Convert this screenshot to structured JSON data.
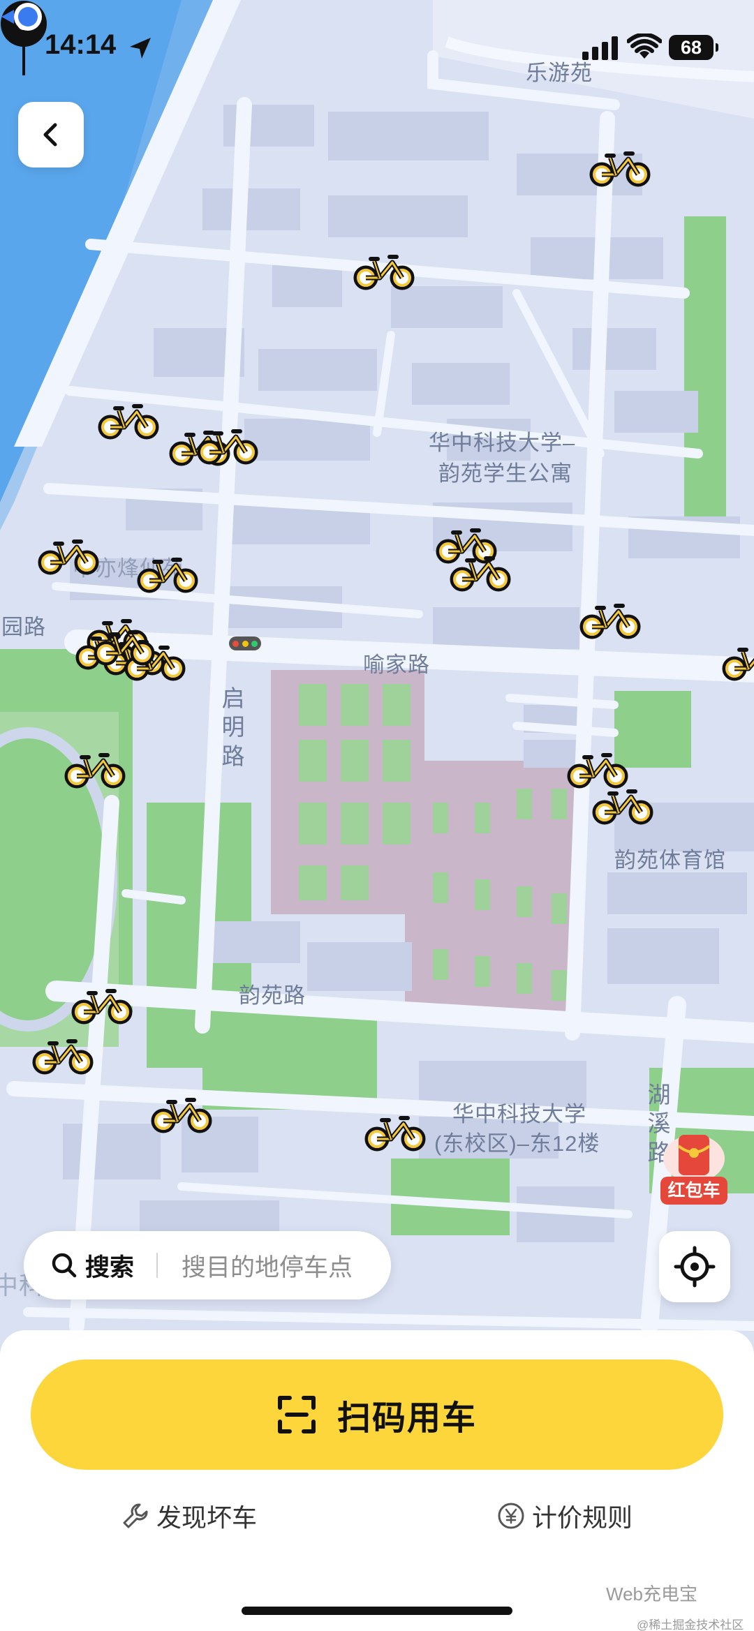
{
  "status_bar": {
    "time": "14:14",
    "battery": "68"
  },
  "map": {
    "labels": {
      "leyouyuan": "乐游苑",
      "dorm_line1": "华中科技大学–",
      "dorm_line2": "韵苑学生公寓",
      "yujia_road": "喻家路",
      "qiming_road": "启明路",
      "yunyuan_gym": "韵苑体育馆",
      "yunyuan_road": "韵苑路",
      "east_campus_line1": "华中科技大学",
      "east_campus_line2": "(东校区)–东12楼",
      "huxi_road": "湖溪路",
      "yuan_road": "园路",
      "partial_top_left": "中亦烽仙苑",
      "partial_bottom_left": "中科技大学"
    },
    "hongbao_label": "红包车"
  },
  "search": {
    "label": "搜索",
    "placeholder": "搜目的地停车点"
  },
  "bottom_sheet": {
    "scan_label": "扫码用车",
    "report_label": "发现坏车",
    "pricing_label": "计价规则"
  },
  "watermark": {
    "main": "Web充电宝",
    "sub": "@稀土掘金技术社区"
  },
  "colors": {
    "accent_yellow": "#fcd63a",
    "bike_yellow": "#f6c93a",
    "map_bg": "#d9e1f3",
    "road": "#f1f5fd",
    "green_area": "#8fcf8c",
    "water": "#5aa6ec",
    "user_dot": "#3a7cf0"
  },
  "icons": [
    "arrow-icon",
    "signal-icon",
    "wifi-icon",
    "back-chevron-icon",
    "search-icon",
    "locate-icon",
    "scan-icon",
    "wrench-icon",
    "yen-icon",
    "bike-icon",
    "pin-icon",
    "hongbao-icon"
  ]
}
